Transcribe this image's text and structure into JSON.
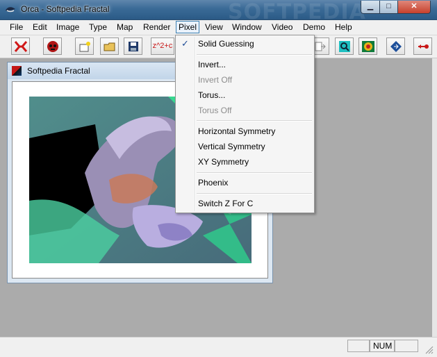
{
  "window": {
    "title": "Orca - Softpedia Fractal",
    "watermark": "SOFTPEDIA",
    "minimize_glyph": "▁",
    "maximize_glyph": "□",
    "close_glyph": "✕"
  },
  "menubar": {
    "items": [
      {
        "label": "File"
      },
      {
        "label": "Edit"
      },
      {
        "label": "Image"
      },
      {
        "label": "Type"
      },
      {
        "label": "Map"
      },
      {
        "label": "Render"
      },
      {
        "label": "Pixel"
      },
      {
        "label": "View"
      },
      {
        "label": "Window"
      },
      {
        "label": "Video"
      },
      {
        "label": "Demo"
      },
      {
        "label": "Help"
      }
    ]
  },
  "toolbar": {
    "formula_label": "z^2+c"
  },
  "child_window": {
    "title": "Softpedia Fractal"
  },
  "pixel_menu": {
    "items": [
      {
        "label": "Solid Guessing",
        "checked": true,
        "enabled": true
      },
      {
        "label": "Invert...",
        "enabled": true
      },
      {
        "label": "Invert Off",
        "enabled": false
      },
      {
        "label": "Torus...",
        "enabled": true
      },
      {
        "label": "Torus Off",
        "enabled": false
      },
      {
        "label": "Horizontal Symmetry",
        "enabled": true
      },
      {
        "label": "Vertical Symmetry",
        "enabled": true
      },
      {
        "label": "XY Symmetry",
        "enabled": true
      },
      {
        "label": "Phoenix",
        "enabled": true
      },
      {
        "label": "Switch Z For C",
        "enabled": true
      }
    ],
    "check_glyph": "✓"
  },
  "statusbar": {
    "num_label": "NUM"
  },
  "colors": {
    "title_bar": "#3a6a96",
    "menu_highlight": "#3c7fb1",
    "mdi_background": "#ababab",
    "close_button": "#c7402c"
  }
}
